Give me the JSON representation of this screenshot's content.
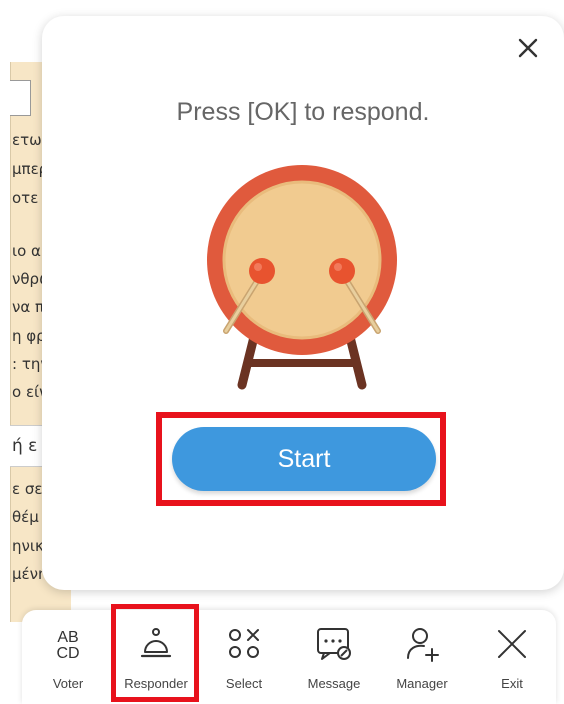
{
  "background": {
    "lines": [
      "ετωπ",
      "μπερ",
      "οτε",
      "ιο α",
      "νθρώ",
      "να π",
      "η φρ",
      ": την",
      "ο είν",
      "ή ε",
      "ε σε",
      "θέμ",
      "ηνικ",
      "μένη"
    ]
  },
  "popup": {
    "prompt": "Press [OK] to respond.",
    "start_label": "Start",
    "close_icon": "close-icon",
    "illustration": "drum-icon"
  },
  "toolbar": {
    "items": [
      {
        "label": "Voter",
        "icon": "abcd-icon"
      },
      {
        "label": "Responder",
        "icon": "bell-icon"
      },
      {
        "label": "Select",
        "icon": "select-icon"
      },
      {
        "label": "Message",
        "icon": "message-icon"
      },
      {
        "label": "Manager",
        "icon": "user-add-icon"
      },
      {
        "label": "Exit",
        "icon": "exit-icon"
      }
    ]
  },
  "colors": {
    "accent": "#3e98de",
    "highlight": "#e8121c",
    "drum_rim": "#e05a3d",
    "drum_face": "#f1cb90",
    "stand": "#6b3322"
  }
}
